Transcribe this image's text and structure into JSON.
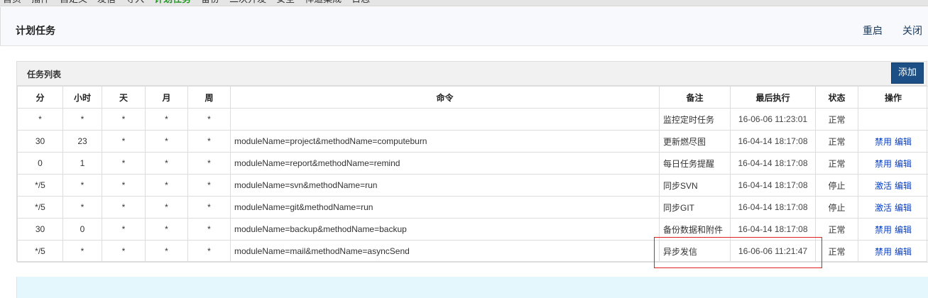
{
  "nav": {
    "items": [
      "首页",
      "插件",
      "自定义",
      "发信",
      "导入",
      "计划任务",
      "备份",
      "二次开发",
      "安全",
      "禅道集成",
      "日志"
    ],
    "active": 5
  },
  "header": {
    "title": "计划任务",
    "restart": "重启",
    "close": "关闭"
  },
  "panel": {
    "title": "任务列表",
    "add": "添加"
  },
  "table": {
    "headers": [
      "分",
      "小时",
      "天",
      "月",
      "周",
      "命令",
      "备注",
      "最后执行",
      "状态",
      "操作"
    ],
    "rows": [
      {
        "min": "*",
        "hour": "*",
        "day": "*",
        "month": "*",
        "week": "*",
        "cmd": "",
        "note": "监控定时任务",
        "last": "16-06-06 11:23:01",
        "status": "正常",
        "actions": []
      },
      {
        "min": "30",
        "hour": "23",
        "day": "*",
        "month": "*",
        "week": "*",
        "cmd": "moduleName=project&methodName=computeburn",
        "note": "更新燃尽图",
        "last": "16-04-14 18:17:08",
        "status": "正常",
        "actions": [
          "禁用",
          "编辑"
        ]
      },
      {
        "min": "0",
        "hour": "1",
        "day": "*",
        "month": "*",
        "week": "*",
        "cmd": "moduleName=report&methodName=remind",
        "note": "每日任务提醒",
        "last": "16-04-14 18:17:08",
        "status": "正常",
        "actions": [
          "禁用",
          "编辑"
        ]
      },
      {
        "min": "*/5",
        "hour": "*",
        "day": "*",
        "month": "*",
        "week": "*",
        "cmd": "moduleName=svn&methodName=run",
        "note": "同步SVN",
        "last": "16-04-14 18:17:08",
        "status": "停止",
        "actions": [
          "激活",
          "编辑"
        ]
      },
      {
        "min": "*/5",
        "hour": "*",
        "day": "*",
        "month": "*",
        "week": "*",
        "cmd": "moduleName=git&methodName=run",
        "note": "同步GIT",
        "last": "16-04-14 18:17:08",
        "status": "停止",
        "actions": [
          "激活",
          "编辑"
        ]
      },
      {
        "min": "30",
        "hour": "0",
        "day": "*",
        "month": "*",
        "week": "*",
        "cmd": "moduleName=backup&methodName=backup",
        "note": "备份数据和附件",
        "last": "16-04-14 18:17:08",
        "status": "正常",
        "actions": [
          "禁用",
          "编辑"
        ]
      },
      {
        "min": "*/5",
        "hour": "*",
        "day": "*",
        "month": "*",
        "week": "*",
        "cmd": "moduleName=mail&methodName=asyncSend",
        "note": "异步发信",
        "last": "16-06-06 11:21:47",
        "status": "正常",
        "actions": [
          "禁用",
          "编辑"
        ]
      }
    ]
  }
}
